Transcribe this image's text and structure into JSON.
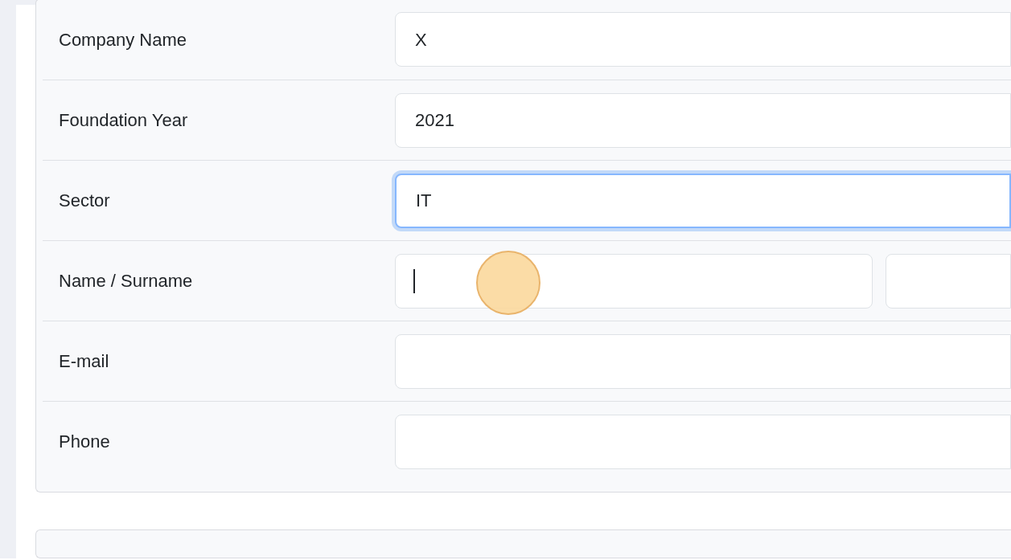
{
  "form": {
    "rows": [
      {
        "label": "Company Name",
        "inputs": [
          {
            "value": "X",
            "focused": false,
            "caret": false
          }
        ]
      },
      {
        "label": "Foundation Year",
        "inputs": [
          {
            "value": "2021",
            "focused": false,
            "caret": false
          }
        ]
      },
      {
        "label": "Sector",
        "inputs": [
          {
            "value": "IT",
            "focused": true,
            "caret": false
          }
        ]
      },
      {
        "label": "Name / Surname",
        "inputs": [
          {
            "focused": false,
            "caret": true
          },
          {
            "focused": false,
            "caret": false
          }
        ]
      },
      {
        "label": "E-mail",
        "inputs": [
          {
            "focused": false,
            "caret": false
          }
        ]
      },
      {
        "label": "Phone",
        "inputs": [
          {
            "focused": false,
            "caret": false
          }
        ]
      }
    ]
  }
}
